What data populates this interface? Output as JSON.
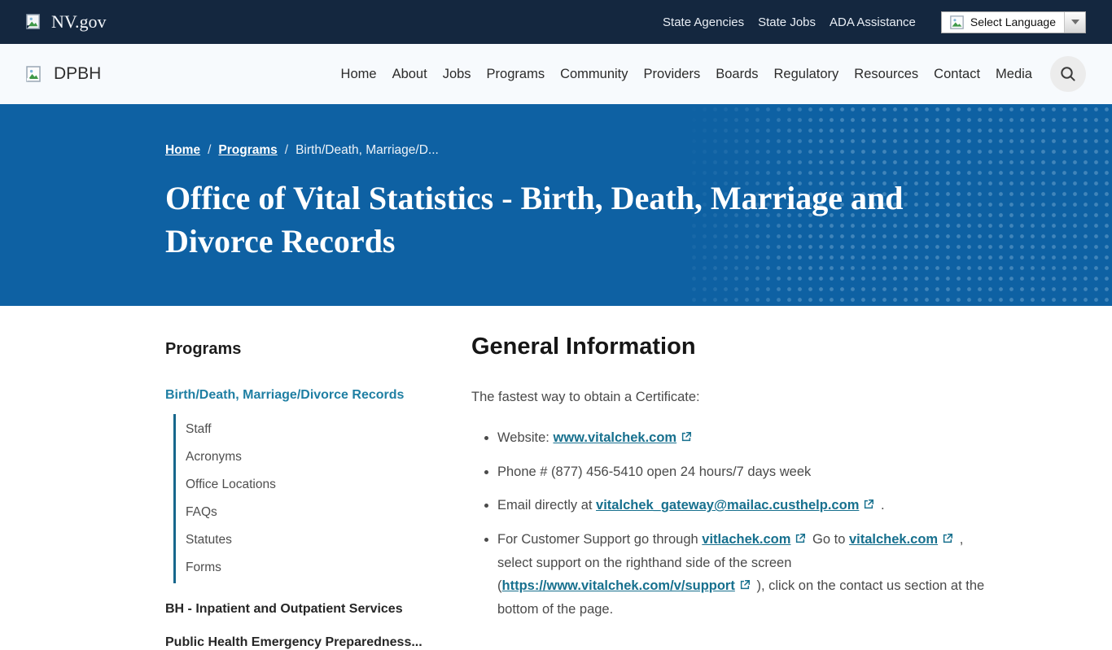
{
  "utility_bar": {
    "brand": "NV.gov",
    "links": [
      "State Agencies",
      "State Jobs",
      "ADA Assistance"
    ],
    "language_selector_label": "Select Language"
  },
  "nav": {
    "brand": "DPBH",
    "items": [
      "Home",
      "About",
      "Jobs",
      "Programs",
      "Community",
      "Providers",
      "Boards",
      "Regulatory",
      "Resources",
      "Contact",
      "Media"
    ]
  },
  "hero": {
    "breadcrumb": {
      "home": "Home",
      "separator": "/",
      "programs": "Programs",
      "current": "Birth/Death, Marriage/D..."
    },
    "title": "Office of Vital Statistics - Birth, Death, Marriage and Divorce Records"
  },
  "sidebar": {
    "heading": "Programs",
    "active_item": "Birth/Death, Marriage/Divorce Records",
    "sub_items": [
      "Staff",
      "Acronyms",
      "Office Locations",
      "FAQs",
      "Statutes",
      "Forms"
    ],
    "other_items": [
      "BH - Inpatient and Outpatient Services",
      "Public Health Emergency Preparedness..."
    ]
  },
  "main": {
    "heading": "General Information",
    "intro": "The fastest way to obtain a Certificate:",
    "bullets": [
      {
        "segments": [
          {
            "t": "Website: "
          },
          {
            "l": "www.vitalchek.com"
          }
        ]
      },
      {
        "segments": [
          {
            "t": "Phone # (877) 456-5410 open 24 hours/7 days week"
          }
        ]
      },
      {
        "segments": [
          {
            "t": "Email directly at "
          },
          {
            "l": "vitalchek_gateway@mailac.custhelp.com"
          },
          {
            "t": " ."
          }
        ]
      },
      {
        "segments": [
          {
            "t": "For Customer Support go through "
          },
          {
            "l": "vitlachek.com"
          },
          {
            "t": "  Go to "
          },
          {
            "l": "vitalchek.com"
          },
          {
            "t": " , select support on the righthand side of the screen ("
          },
          {
            "l": "https://www.vitalchek.com/v/support"
          },
          {
            "t": " ), click on the contact us section at the bottom of the page."
          }
        ]
      }
    ]
  },
  "icons": {
    "broken_image": "broken-image-icon",
    "search": "search-icon",
    "external_link": "external-link-icon",
    "dropdown_arrow": "chevron-down-icon"
  },
  "colors": {
    "utility_bar_bg": "#14273f",
    "nav_bg": "#f7fafd",
    "hero_bg": "#0e61a3",
    "link_teal": "#17708e",
    "sidebar_rule": "#16678c"
  }
}
